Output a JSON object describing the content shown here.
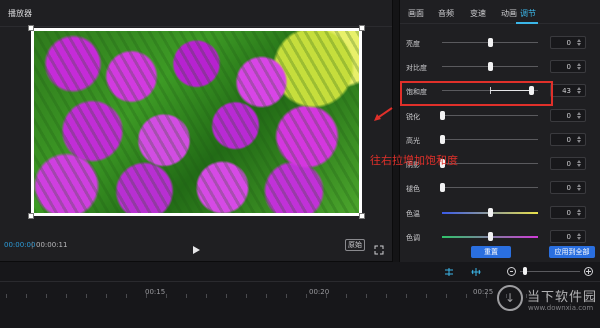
{
  "player": {
    "title": "播放器",
    "time_current": "00:00:00",
    "time_total": "00:00:11",
    "ratio_label": "原始"
  },
  "panel": {
    "tabs": [
      {
        "label": "画面"
      },
      {
        "label": "音频"
      },
      {
        "label": "变速"
      },
      {
        "label": "动画"
      },
      {
        "label": "调节",
        "active": true
      }
    ],
    "sliders": [
      {
        "label": "亮度",
        "value": "0",
        "level": 0.5
      },
      {
        "label": "对比度",
        "value": "0",
        "level": 0.5
      },
      {
        "label": "饱和度",
        "value": "43",
        "level": 0.93
      },
      {
        "label": "锐化",
        "value": "0",
        "level": 0.0
      },
      {
        "label": "高光",
        "value": "0",
        "level": 0.0
      },
      {
        "label": "阴影",
        "value": "0",
        "level": 0.0
      },
      {
        "label": "褪色",
        "value": "0",
        "level": 0.0
      },
      {
        "label": "色温",
        "value": "0",
        "level": 0.5
      },
      {
        "label": "色调",
        "value": "0",
        "level": 0.5
      }
    ],
    "reset_label": "重置",
    "apply_all_label": "应用到全部"
  },
  "annotation": {
    "text": "往右拉增加饱和度",
    "color": "#e0302a"
  },
  "timeline": {
    "ticks": [
      "00:15",
      "00:20",
      "00:25"
    ]
  },
  "watermark": {
    "name": "当下软件园",
    "domain": "www.downxia.com"
  },
  "colors": {
    "accent": "#3bb6e8",
    "button": "#2a6fe0"
  }
}
